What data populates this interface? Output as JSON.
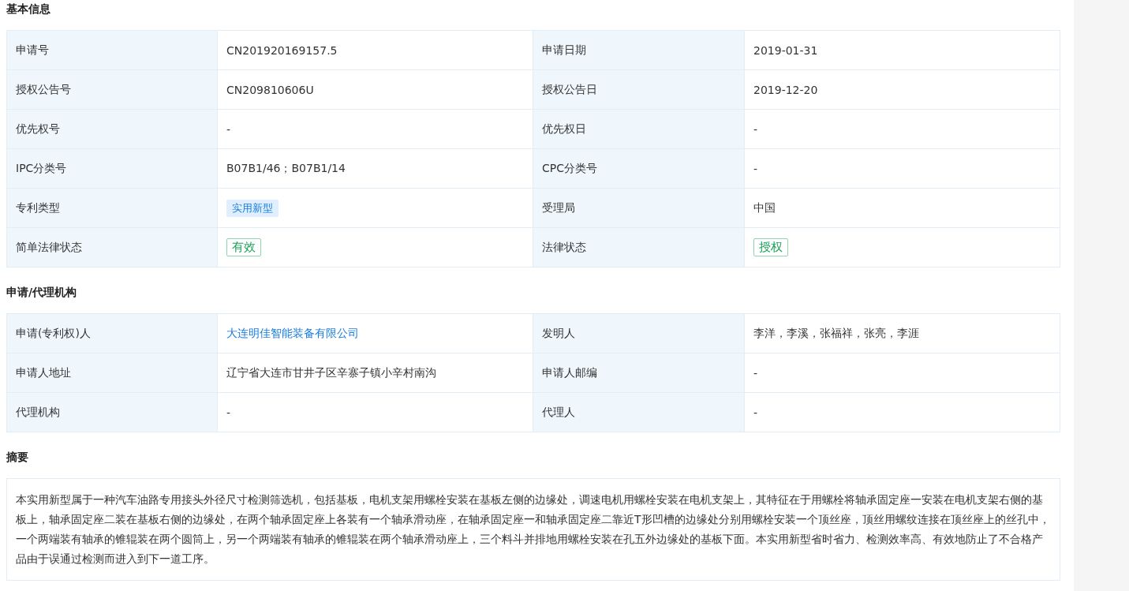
{
  "sections": [
    {
      "kind": "table",
      "title": "基本信息",
      "rows": [
        [
          {
            "label": "申请号",
            "value": {
              "kind": "text",
              "text": "CN201920169157.5"
            }
          },
          {
            "label": "申请日期",
            "value": {
              "kind": "text",
              "text": "2019-01-31"
            }
          }
        ],
        [
          {
            "label": "授权公告号",
            "value": {
              "kind": "text",
              "text": "CN209810606U"
            }
          },
          {
            "label": "授权公告日",
            "value": {
              "kind": "text",
              "text": "2019-12-20"
            }
          }
        ],
        [
          {
            "label": "优先权号",
            "value": {
              "kind": "text",
              "text": "-"
            }
          },
          {
            "label": "优先权日",
            "value": {
              "kind": "text",
              "text": "-"
            }
          }
        ],
        [
          {
            "label": "IPC分类号",
            "value": {
              "kind": "text",
              "text": "B07B1/46；B07B1/14"
            }
          },
          {
            "label": "CPC分类号",
            "value": {
              "kind": "text",
              "text": "-"
            }
          }
        ],
        [
          {
            "label": "专利类型",
            "value": {
              "kind": "type_tag",
              "text": "实用新型"
            }
          },
          {
            "label": "受理局",
            "value": {
              "kind": "text",
              "text": "中国"
            }
          }
        ],
        [
          {
            "label": "简单法律状态",
            "value": {
              "kind": "status_tag",
              "text": "有效"
            }
          },
          {
            "label": "法律状态",
            "value": {
              "kind": "status_tag",
              "text": "授权"
            }
          }
        ]
      ]
    },
    {
      "kind": "table",
      "title": "申请/代理机构",
      "rows": [
        [
          {
            "label": "申请(专利权)人",
            "value": {
              "kind": "link",
              "text": "大连明佳智能装备有限公司"
            }
          },
          {
            "label": "发明人",
            "value": {
              "kind": "text",
              "text": "李洋，李溪，张福祥，张亮，李涯"
            }
          }
        ],
        [
          {
            "label": "申请人地址",
            "value": {
              "kind": "text",
              "text": "辽宁省大连市甘井子区辛寨子镇小辛村南沟"
            }
          },
          {
            "label": "申请人邮编",
            "value": {
              "kind": "text",
              "text": "-"
            }
          }
        ],
        [
          {
            "label": "代理机构",
            "value": {
              "kind": "text",
              "text": "-"
            }
          },
          {
            "label": "代理人",
            "value": {
              "kind": "text",
              "text": "-"
            }
          }
        ]
      ]
    },
    {
      "kind": "text",
      "title": "摘要",
      "text": "本实用新型属于一种汽车油路专用接头外径尺寸检测筛选机，包括基板，电机支架用螺栓安装在基板左侧的边缘处，调速电机用螺栓安装在电机支架上，其特征在于用螺栓将轴承固定座一安装在电机支架右侧的基板上，轴承固定座二装在基板右侧的边缘处，在两个轴承固定座上各装有一个轴承滑动座，在轴承固定座一和轴承固定座二靠近T形凹槽的边缘处分别用螺栓安装一个顶丝座，顶丝用螺纹连接在顶丝座上的丝孔中，一个两端装有轴承的锥辊装在两个圆筒上，另一个两端装有轴承的锥辊装在两个轴承滑动座上，三个料斗并排地用螺栓安装在孔五外边缘处的基板下面。本实用新型省时省力、检测效率高、有效地防止了不合格产品由于误通过检测而进入到下一道工序。"
    }
  ]
}
